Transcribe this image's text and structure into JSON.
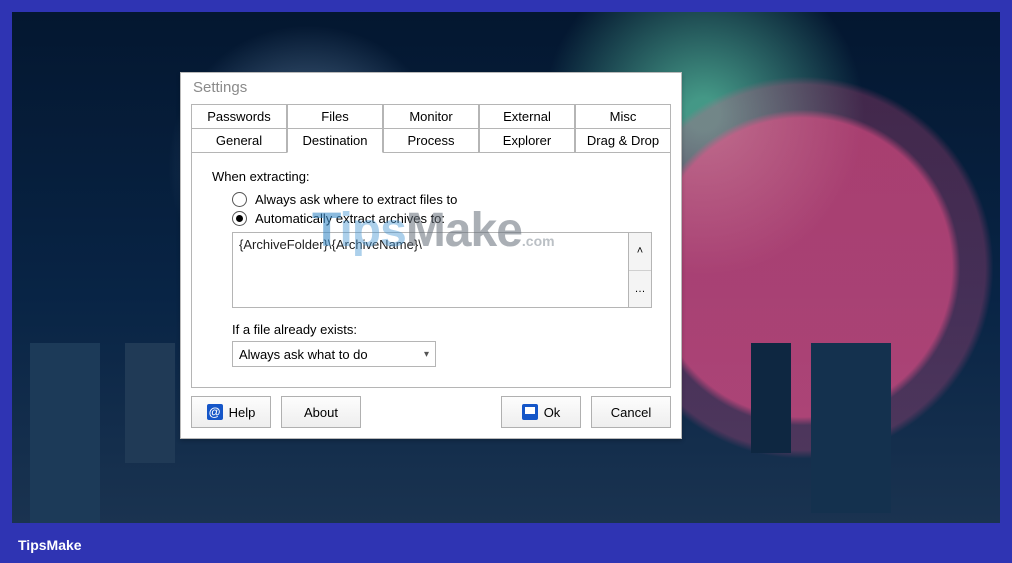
{
  "watermark_site": "TipsMake",
  "dialog": {
    "title": "Settings",
    "tabs_row1": [
      {
        "label": "Passwords"
      },
      {
        "label": "Files"
      },
      {
        "label": "Monitor"
      },
      {
        "label": "External"
      },
      {
        "label": "Misc"
      }
    ],
    "tabs_row2": [
      {
        "label": "General"
      },
      {
        "label": "Destination",
        "selected": true
      },
      {
        "label": "Process"
      },
      {
        "label": "Explorer"
      },
      {
        "label": "Drag & Drop"
      }
    ],
    "destination": {
      "section_label": "When extracting:",
      "radio_ask": "Always ask where to extract files to",
      "radio_auto": "Automatically extract archives to:",
      "radio_selected": "auto",
      "path_value": "{ArchiveFolder}\\{ArchiveName}\\",
      "exists_label": "If a file already exists:",
      "exists_value": "Always ask what to do"
    },
    "buttons": {
      "help": "Help",
      "about": "About",
      "ok": "Ok",
      "cancel": "Cancel"
    }
  },
  "caption": "TipsMake"
}
